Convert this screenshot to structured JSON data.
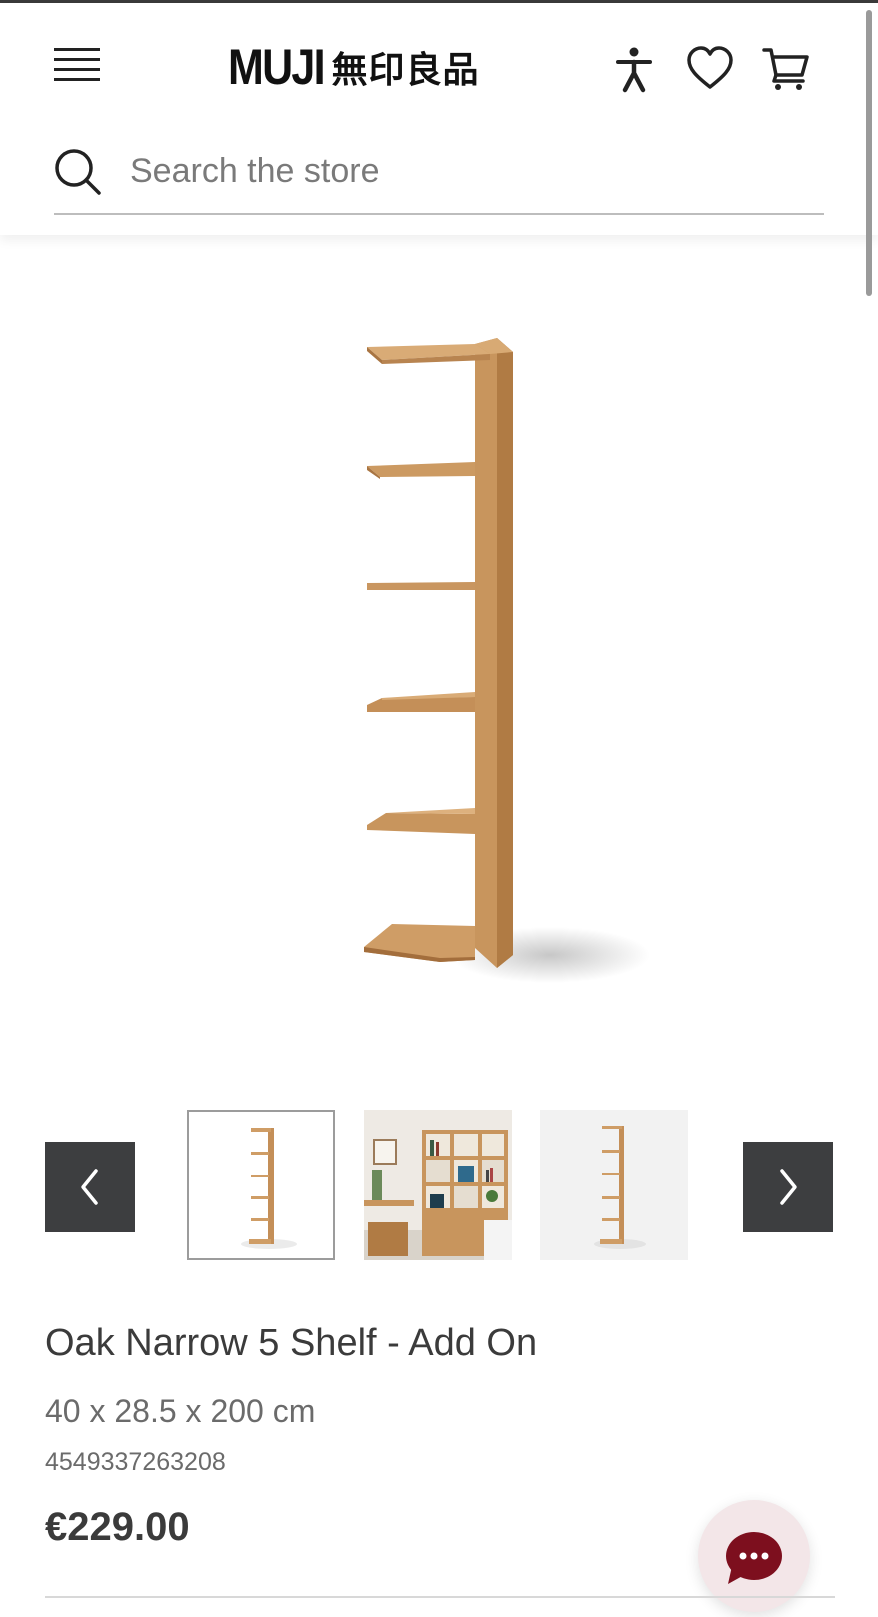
{
  "header": {
    "logo_latin": "MUJI",
    "logo_kanji": "無印良品",
    "menu_icon": "hamburger-menu-icon",
    "accessibility_icon": "accessibility-icon",
    "wishlist_icon": "heart-icon",
    "cart_icon": "cart-icon"
  },
  "search": {
    "placeholder": "Search the store",
    "icon": "search-icon"
  },
  "gallery": {
    "prev_icon": "chevron-left-icon",
    "next_icon": "chevron-right-icon",
    "thumbnails": [
      "shelf-unit-front",
      "shelf-room-scene",
      "shelf-unit-side"
    ],
    "active_index": 0
  },
  "product": {
    "title": "Oak Narrow 5 Shelf - Add On",
    "dimensions": "40 x 28.5 x 200 cm",
    "sku": "4549337263208",
    "price": "€229.00"
  },
  "chat": {
    "icon": "chat-bubble-icon"
  },
  "colors": {
    "nav_button": "#3d3e40",
    "oak": "#c8955d",
    "chat_bubble": "#7d0f1e"
  }
}
